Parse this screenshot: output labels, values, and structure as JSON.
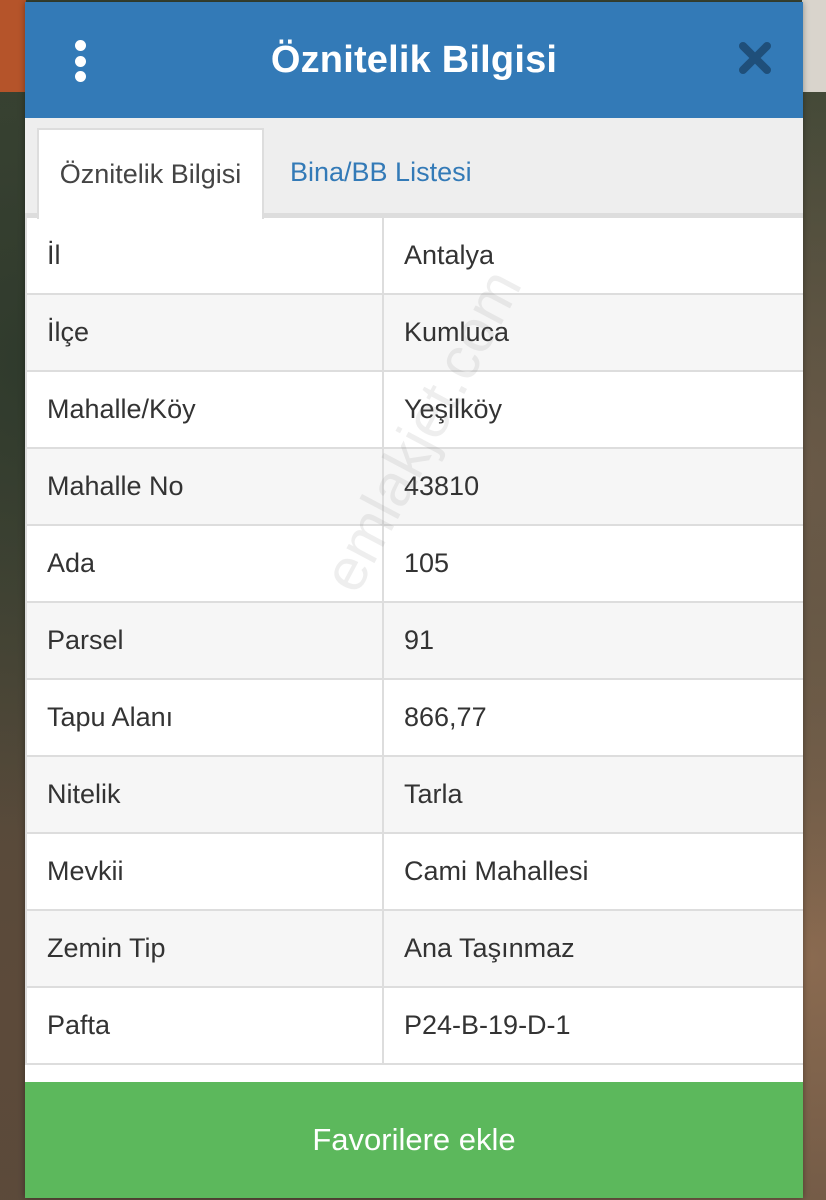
{
  "dialog": {
    "title": "Öznitelik Bilgisi",
    "menu_icon": "vertical-ellipsis-icon",
    "close_icon": "close-icon"
  },
  "tabs": [
    {
      "label": "Öznitelik Bilgisi",
      "active": true
    },
    {
      "label": "Bina/BB Listesi",
      "active": false
    }
  ],
  "attributes": [
    {
      "key": "İl",
      "value": "Antalya"
    },
    {
      "key": "İlçe",
      "value": "Kumluca"
    },
    {
      "key": "Mahalle/Köy",
      "value": "Yeşilköy"
    },
    {
      "key": "Mahalle No",
      "value": "43810"
    },
    {
      "key": "Ada",
      "value": "105"
    },
    {
      "key": "Parsel",
      "value": "91"
    },
    {
      "key": "Tapu Alanı",
      "value": "866,77"
    },
    {
      "key": "Nitelik",
      "value": "Tarla"
    },
    {
      "key": "Mevkii",
      "value": "Cami Mahallesi"
    },
    {
      "key": "Zemin Tip",
      "value": "Ana Taşınmaz"
    },
    {
      "key": "Pafta",
      "value": "P24-B-19-D-1"
    }
  ],
  "watermark": "emlakjet.com",
  "footer": {
    "button_label": "Favorilere ekle"
  },
  "colors": {
    "header": "#337ab7",
    "button": "#5cb85c"
  }
}
